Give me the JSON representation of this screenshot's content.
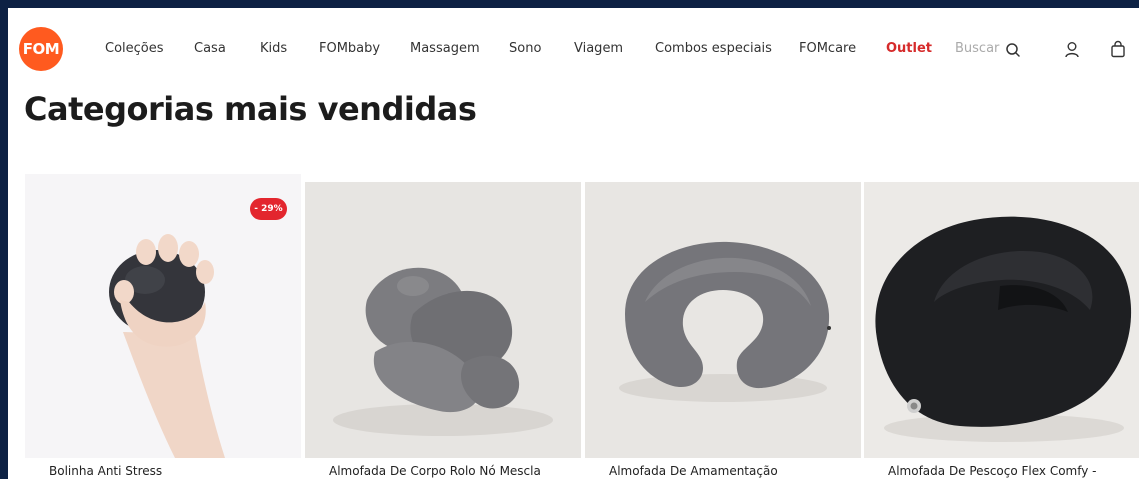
{
  "brand": {
    "logo_text": "FOM",
    "logo_color": "#ff5a1f"
  },
  "nav": {
    "items": [
      {
        "label": "Coleções"
      },
      {
        "label": "Casa"
      },
      {
        "label": "Kids"
      },
      {
        "label": "FOMbaby"
      },
      {
        "label": "Massagem"
      },
      {
        "label": "Sono"
      },
      {
        "label": "Viagem"
      },
      {
        "label": "Combos especiais"
      },
      {
        "label": "FOMcare"
      },
      {
        "label": "Outlet"
      }
    ],
    "outlet_color": "#d62b2b"
  },
  "search": {
    "placeholder": "Buscar"
  },
  "icons": {
    "search": "search-icon",
    "account": "user-icon",
    "cart": "shopping-bag-icon"
  },
  "section": {
    "title": "Categorias mais vendidas"
  },
  "products": [
    {
      "name": "Bolinha Anti Stress",
      "badge": "- 29%"
    },
    {
      "name": "Almofada De Corpo Rolo Nó Mescla"
    },
    {
      "name": "Almofada De Amamentação"
    },
    {
      "name": "Almofada De Pescoço Flex Comfy -"
    }
  ],
  "colors": {
    "frame": "#0d2144",
    "badge": "#e3262e"
  }
}
